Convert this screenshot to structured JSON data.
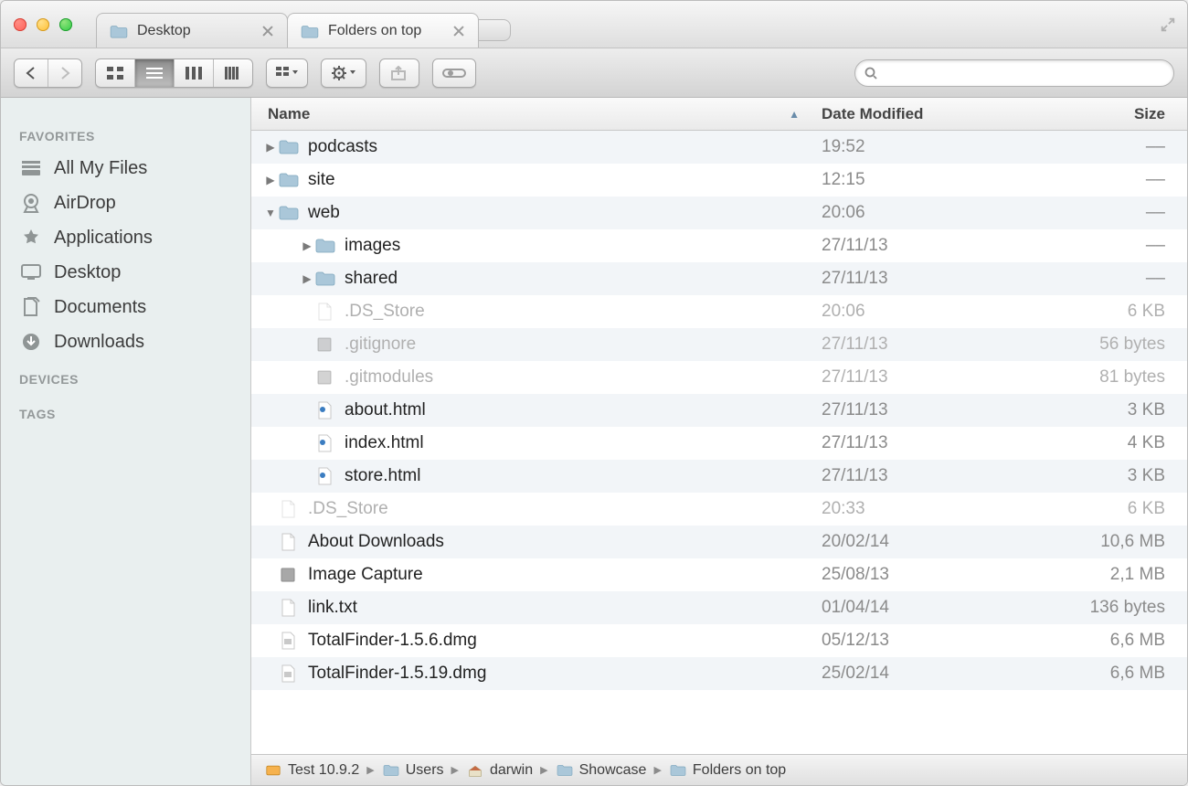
{
  "tabs": [
    {
      "label": "Desktop",
      "active": false
    },
    {
      "label": "Folders on top",
      "active": true
    }
  ],
  "sidebar": {
    "sections": [
      {
        "heading": "FAVORITES",
        "items": [
          {
            "label": "All My Files",
            "icon": "stack-icon"
          },
          {
            "label": "AirDrop",
            "icon": "airdrop-icon"
          },
          {
            "label": "Applications",
            "icon": "applications-icon"
          },
          {
            "label": "Desktop",
            "icon": "desktop-icon"
          },
          {
            "label": "Documents",
            "icon": "documents-icon"
          },
          {
            "label": "Downloads",
            "icon": "downloads-icon"
          }
        ]
      },
      {
        "heading": "DEVICES",
        "items": []
      },
      {
        "heading": "TAGS",
        "items": []
      }
    ]
  },
  "columns": {
    "name": "Name",
    "date": "Date Modified",
    "size": "Size"
  },
  "rows": [
    {
      "indent": 0,
      "disclosure": "closed",
      "icon": "folder-icon",
      "name": "podcasts",
      "date": "19:52",
      "size": "––",
      "dimmed": false
    },
    {
      "indent": 0,
      "disclosure": "closed",
      "icon": "folder-icon",
      "name": "site",
      "date": "12:15",
      "size": "––",
      "dimmed": false
    },
    {
      "indent": 0,
      "disclosure": "open",
      "icon": "folder-icon",
      "name": "web",
      "date": "20:06",
      "size": "––",
      "dimmed": false
    },
    {
      "indent": 1,
      "disclosure": "closed",
      "icon": "folder-icon",
      "name": "images",
      "date": "27/11/13",
      "size": "––",
      "dimmed": false
    },
    {
      "indent": 1,
      "disclosure": "closed",
      "icon": "folder-icon",
      "name": "shared",
      "date": "27/11/13",
      "size": "––",
      "dimmed": false
    },
    {
      "indent": 1,
      "disclosure": "none",
      "icon": "file-icon",
      "name": ".DS_Store",
      "date": "20:06",
      "size": "6 KB",
      "dimmed": true
    },
    {
      "indent": 1,
      "disclosure": "none",
      "icon": "unix-file-icon",
      "name": ".gitignore",
      "date": "27/11/13",
      "size": "56 bytes",
      "dimmed": true
    },
    {
      "indent": 1,
      "disclosure": "none",
      "icon": "unix-file-icon",
      "name": ".gitmodules",
      "date": "27/11/13",
      "size": "81 bytes",
      "dimmed": true
    },
    {
      "indent": 1,
      "disclosure": "none",
      "icon": "html-file-icon",
      "name": "about.html",
      "date": "27/11/13",
      "size": "3 KB",
      "dimmed": false
    },
    {
      "indent": 1,
      "disclosure": "none",
      "icon": "html-file-icon",
      "name": "index.html",
      "date": "27/11/13",
      "size": "4 KB",
      "dimmed": false
    },
    {
      "indent": 1,
      "disclosure": "none",
      "icon": "html-file-icon",
      "name": "store.html",
      "date": "27/11/13",
      "size": "3 KB",
      "dimmed": false
    },
    {
      "indent": 0,
      "disclosure": "none",
      "icon": "file-icon",
      "name": ".DS_Store",
      "date": "20:33",
      "size": "6 KB",
      "dimmed": true
    },
    {
      "indent": 0,
      "disclosure": "none",
      "icon": "rtf-file-icon",
      "name": "About Downloads",
      "date": "20/02/14",
      "size": "10,6 MB",
      "dimmed": false
    },
    {
      "indent": 0,
      "disclosure": "none",
      "icon": "app-icon",
      "name": "Image Capture",
      "date": "25/08/13",
      "size": "2,1 MB",
      "dimmed": false
    },
    {
      "indent": 0,
      "disclosure": "none",
      "icon": "txt-file-icon",
      "name": "link.txt",
      "date": "01/04/14",
      "size": "136 bytes",
      "dimmed": false
    },
    {
      "indent": 0,
      "disclosure": "none",
      "icon": "dmg-file-icon",
      "name": "TotalFinder-1.5.6.dmg",
      "date": "05/12/13",
      "size": "6,6 MB",
      "dimmed": false
    },
    {
      "indent": 0,
      "disclosure": "none",
      "icon": "dmg-file-icon",
      "name": "TotalFinder-1.5.19.dmg",
      "date": "25/02/14",
      "size": "6,6 MB",
      "dimmed": false
    }
  ],
  "path": [
    {
      "label": "Test 10.9.2",
      "icon": "drive-icon"
    },
    {
      "label": "Users",
      "icon": "folder-icon"
    },
    {
      "label": "darwin",
      "icon": "home-icon"
    },
    {
      "label": "Showcase",
      "icon": "folder-icon"
    },
    {
      "label": "Folders on top",
      "icon": "folder-icon"
    }
  ],
  "search": {
    "placeholder": ""
  }
}
